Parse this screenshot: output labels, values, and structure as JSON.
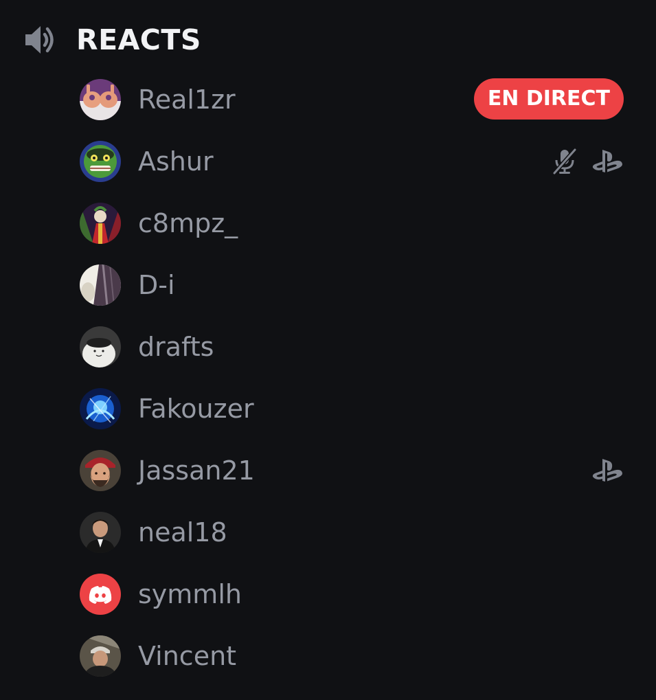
{
  "channel": {
    "name": "REACTS",
    "icon": "speaker-icon"
  },
  "members": [
    {
      "name": "Real1zr",
      "badge": "EN DIRECT",
      "icons": []
    },
    {
      "name": "Ashur",
      "icons": [
        "mic-muted-icon",
        "playstation-icon"
      ]
    },
    {
      "name": "c8mpz_",
      "icons": []
    },
    {
      "name": "D-i",
      "icons": []
    },
    {
      "name": "drafts",
      "icons": []
    },
    {
      "name": "Fakouzer",
      "icons": []
    },
    {
      "name": "Jassan21",
      "icons": [
        "playstation-icon"
      ]
    },
    {
      "name": "neal18",
      "icons": []
    },
    {
      "name": "symmlh",
      "icons": []
    },
    {
      "name": "Vincent",
      "icons": []
    }
  ],
  "colors": {
    "background": "#101114",
    "channel_name": "#f2f3f5",
    "member_name": "#969aa4",
    "live_badge": "#ed4245",
    "icon_gray": "#80848e",
    "discord_default_avatar": "#ed4245"
  }
}
